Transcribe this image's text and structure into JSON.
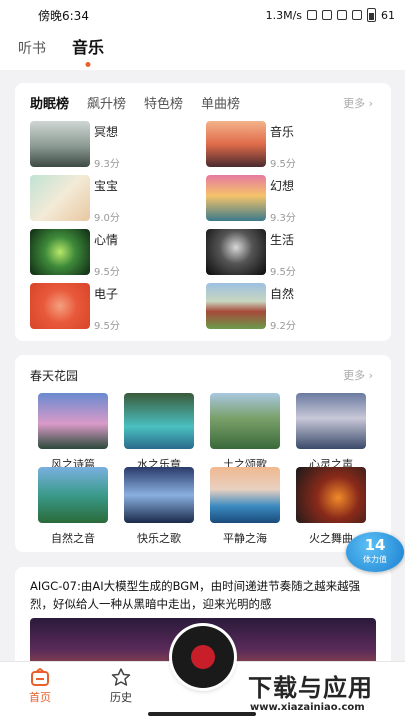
{
  "status_bar": {
    "time": "傍晚6:34",
    "speed": "1.3M/s",
    "battery": "61"
  },
  "top_tabs": [
    "听书",
    "音乐"
  ],
  "ranking": {
    "tabs": [
      "助眠榜",
      "飙升榜",
      "特色榜",
      "单曲榜"
    ],
    "more": "更多",
    "items": [
      {
        "name": "冥想",
        "score": "9.3分"
      },
      {
        "name": "音乐",
        "score": "9.5分"
      },
      {
        "name": "宝宝",
        "score": "9.0分"
      },
      {
        "name": "幻想",
        "score": "9.3分"
      },
      {
        "name": "心情",
        "score": "9.5分"
      },
      {
        "name": "生活",
        "score": "9.5分"
      },
      {
        "name": "电子",
        "score": "9.5分"
      },
      {
        "name": "自然",
        "score": "9.2分"
      }
    ]
  },
  "garden": {
    "title": "春天花园",
    "more": "更多",
    "items": [
      "风之诗篇",
      "水之乐章",
      "土之颂歌",
      "心灵之声",
      "自然之音",
      "快乐之歌",
      "平静之海",
      "火之舞曲"
    ]
  },
  "feature": {
    "text": "AIGC-07:由AI大模型生成的BGM，由时间递进节奏随之越来越强烈，好似给人一种从黑暗中走出，迎来光明的感"
  },
  "stamina": {
    "value": "14",
    "label": "体力值"
  },
  "tabbar": {
    "home": "首页",
    "history": "历史"
  },
  "watermark": {
    "title": "下载与应用",
    "url": "www.xiazainiao.com"
  }
}
